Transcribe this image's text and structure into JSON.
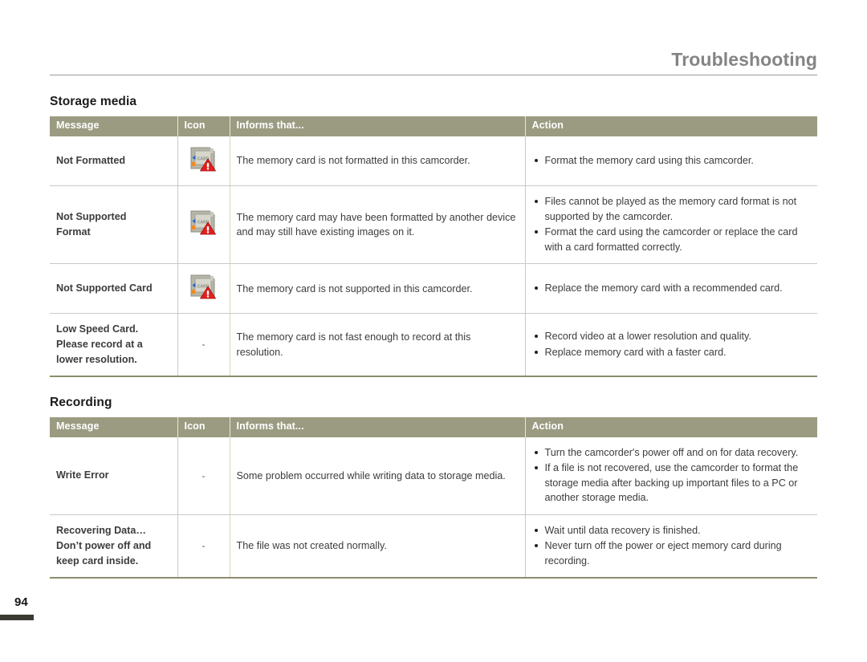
{
  "header": {
    "title": "Troubleshooting"
  },
  "page_footer": {
    "page_number": "94"
  },
  "colors": {
    "table_header_bg": "#9b9b82",
    "table_header_text": "#ffffff",
    "header_title_text": "#848484",
    "table_bottom_border": "#8c8c6e",
    "warning_triangle": "#e02020",
    "card_body": "#b6b6a8",
    "card_arrow": "#2266cc",
    "card_tab": "#f08a20"
  },
  "columns": [
    "Message",
    "Icon",
    "Informs that...",
    "Action"
  ],
  "sections": [
    {
      "id": "storage-media",
      "title": "Storage media",
      "rows": [
        {
          "message": [
            "Not Formatted"
          ],
          "icon": "memory-card-warning-icon",
          "icon_label": "CARD",
          "informs": "The memory card is not formatted in this camcorder.",
          "actions": [
            "Format the memory card using this camcorder."
          ]
        },
        {
          "message": [
            "Not Supported",
            "Format"
          ],
          "icon": "memory-card-warning-icon",
          "icon_label": "CARD",
          "informs": "The memory card may have been formatted by another device and may still have existing images on it.",
          "actions": [
            "Files cannot be played as the memory card format is not supported by the camcorder.",
            "Format the card using the camcorder or replace the card with a card formatted correctly."
          ]
        },
        {
          "message": [
            "Not Supported Card"
          ],
          "icon": "memory-card-warning-icon",
          "icon_label": "CARD",
          "informs": "The memory card is not supported in this camcorder.",
          "actions": [
            "Replace the memory card with a recommended card."
          ]
        },
        {
          "message": [
            "Low Speed Card.",
            "Please record at a",
            "lower resolution."
          ],
          "icon": "dash",
          "icon_label": "-",
          "informs": "The memory card is not fast enough to record at this resolution.",
          "actions": [
            "Record video at a lower resolution and quality.",
            "Replace memory card with a faster card."
          ]
        }
      ]
    },
    {
      "id": "recording",
      "title": "Recording",
      "rows": [
        {
          "message": [
            "Write Error"
          ],
          "icon": "dash",
          "icon_label": "-",
          "informs": "Some problem occurred while writing data to storage media.",
          "actions": [
            "Turn the camcorder's power off and on for data recovery.",
            "If a file is not recovered, use the camcorder to format the storage media after backing up important files to a PC or another storage media."
          ]
        },
        {
          "message": [
            "Recovering Data…",
            "Don’t power off and",
            "keep card inside."
          ],
          "icon": "dash",
          "icon_label": "-",
          "informs": "The file was not created normally.",
          "actions": [
            "Wait until data recovery is finished.",
            "Never turn off the power or eject memory card during recording."
          ]
        }
      ]
    }
  ]
}
